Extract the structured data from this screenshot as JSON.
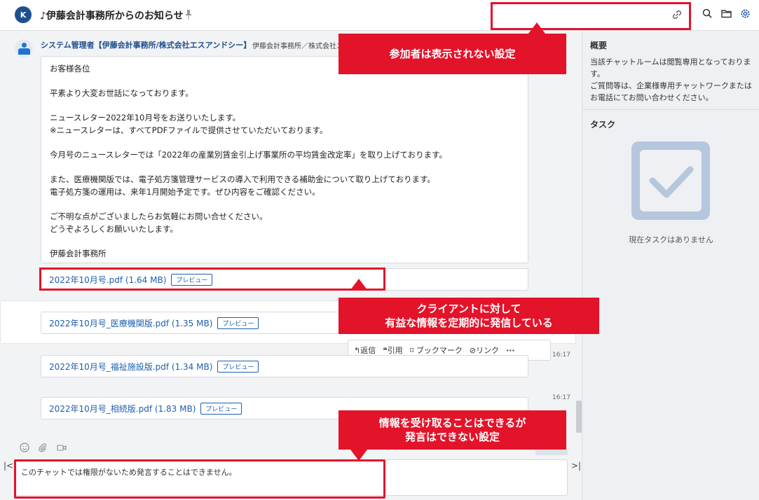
{
  "header": {
    "logo_text": "K",
    "room_title": "♪伊藤会計事務所からのお知らせ"
  },
  "message": {
    "sender": "システム管理者【伊藤会計事務所/株式会社エスアンドシー】",
    "sender_org": "伊藤会計事務所／株式会社エ",
    "body": [
      "お客様各位",
      "平素より大変お世話になっております。",
      "ニュースレター2022年10月号をお送りいたします。\n※ニュースレターは、すべてPDFファイルで提供させていただいております。",
      "今月号のニュースレターでは「2022年の産業別賃金引上げ事業所の平均賃金改定率」を取り上げております。",
      "また、医療機関版では、電子処方箋管理サービスの導入で利用できる補助金について取り上げております。\n電子処方箋の運用は、来年1月開始予定です。ぜひ内容をご確認ください。",
      "ご不明な点がございましたらお気軽にお問い合せください。\nどうぞよろしくお願いいたします。",
      "伊藤会計事務所"
    ]
  },
  "attachments": [
    {
      "name": "2022年10月号.pdf (1.64 MB)",
      "preview": "プレビュー"
    },
    {
      "name": "2022年10月号_医療機関版.pdf (1.35 MB)",
      "preview": "プレビュー"
    },
    {
      "name": "2022年10月号_福祉施設版.pdf (1.34 MB)",
      "preview": "プレビュー",
      "time": "16:17"
    },
    {
      "name": "2022年10月号_相続版.pdf (1.83 MB)",
      "preview": "プレビュー",
      "time": "16:17"
    }
  ],
  "action_bar": {
    "reply": "返信",
    "quote": "引用",
    "bookmark": "ブックマーク",
    "link": "リンク",
    "more": "···"
  },
  "compose": {
    "disabled_text": "このチャットでは権限がないため発言することはできません。"
  },
  "right_panel": {
    "summary_heading": "概要",
    "summary_text": "当該チャットルームは閲覧専用となっております。\nご質問等は、企業様専用チャットワークまたはお電話にてお問い合わせください。",
    "task_heading": "タスク",
    "task_empty": "現在タスクはありません"
  },
  "callouts": {
    "participants": "参加者は表示されない設定",
    "info_line1": "クライアントに対して",
    "info_line2": "有益な情報を定期的に発信している",
    "post_line1": "情報を受け取ることはできるが",
    "post_line2": "発言はできない設定"
  },
  "colors": {
    "accent_red": "#e3132a",
    "link_blue": "#1d5fae",
    "brand_navy": "#1d4f91"
  }
}
